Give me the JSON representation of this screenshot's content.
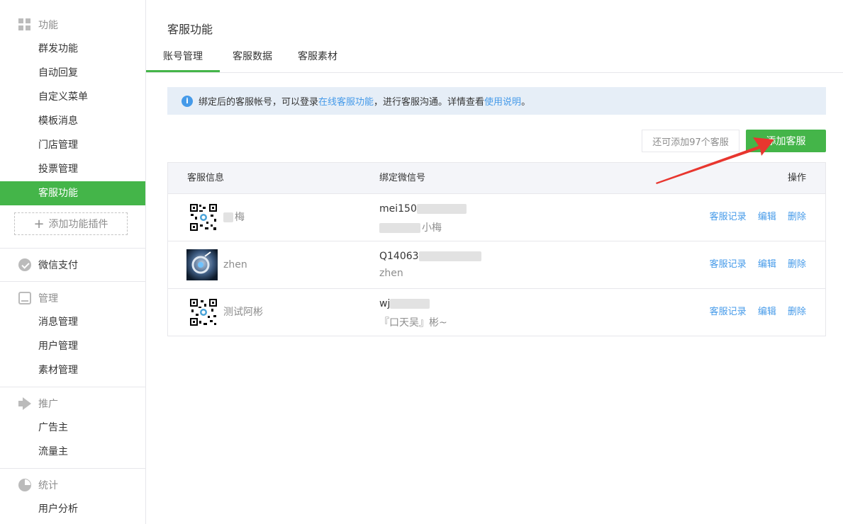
{
  "sidebar": {
    "sections": [
      {
        "title": "功能",
        "icon": "grid-icon",
        "items": [
          "群发功能",
          "自动回复",
          "自定义菜单",
          "模板消息",
          "门店管理",
          "投票管理",
          "客服功能"
        ]
      },
      {
        "title": "微信支付",
        "icon": "chat-icon",
        "items": []
      },
      {
        "title": "管理",
        "icon": "tray-icon",
        "items": [
          "消息管理",
          "用户管理",
          "素材管理"
        ]
      },
      {
        "title": "推广",
        "icon": "megaphone-icon",
        "items": [
          "广告主",
          "流量主"
        ]
      },
      {
        "title": "统计",
        "icon": "pie-chart-icon",
        "items": [
          "用户分析"
        ]
      }
    ],
    "add_plugin": "添加功能插件",
    "active_item": "客服功能"
  },
  "page": {
    "title": "客服功能",
    "tabs": [
      "账号管理",
      "客服数据",
      "客服素材"
    ],
    "active_tab": "账号管理"
  },
  "notice": {
    "text_1": "绑定后的客服帐号，可以登录",
    "link_1": "在线客服功能",
    "text_2": "，进行客服沟通。详情查看",
    "link_2": "使用说明",
    "text_3": "。"
  },
  "toolbar": {
    "remaining": "还可添加97个客服",
    "add_button": "添加客服"
  },
  "table": {
    "headers": {
      "info": "客服信息",
      "wechat": "绑定微信号",
      "ops": "操作"
    },
    "rows": [
      {
        "nick": "梅",
        "wechat_id": "mei150",
        "wechat_nick": "小梅",
        "avatar": "qr"
      },
      {
        "nick": "zhen",
        "wechat_id": "Q14063",
        "wechat_nick": "zhen",
        "avatar": "photo"
      },
      {
        "nick": "测试阿彬",
        "wechat_id": "wj",
        "wechat_nick": "『口天吴』彬~",
        "avatar": "qr"
      }
    ],
    "actions": [
      "客服记录",
      "编辑",
      "删除"
    ]
  },
  "colors": {
    "accent": "#44b549",
    "link": "#459ae9",
    "notice_bg": "#e6eef7",
    "annotation_arrow": "#e8362f"
  }
}
